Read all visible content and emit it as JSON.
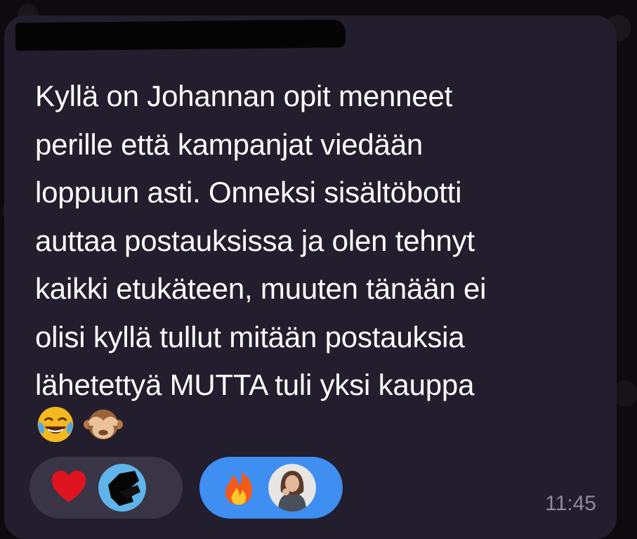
{
  "message": {
    "text": "Kyllä on Johannan opit menneet\nperille että kampanjat viedään\nloppuun asti. Onneksi sisältöbotti\nauttaa postauksissa ja olen tehnyt\nkaikki etukäteen, muuten tänään ei\nolisi kyllä tullut mitään postauksia\nlähetettyä MUTTA tuli yksi kauppa",
    "emojis": [
      "face-with-tears-of-joy-icon",
      "see-no-evil-monkey-icon"
    ],
    "time": "11:45"
  },
  "reactions": [
    {
      "emoji": "red-heart-icon",
      "reactor": "redacted-avatar"
    },
    {
      "emoji": "fire-icon",
      "reactor": "user-photo-avatar",
      "mine": true
    }
  ],
  "colors": {
    "bubble": "#221e2d",
    "background": "#0d0b10",
    "text": "#ffffff",
    "timestamp": "#8e8a99",
    "reaction_other": "#3a3546",
    "reaction_mine": "#3f8ef1",
    "redaction": "#050505"
  }
}
